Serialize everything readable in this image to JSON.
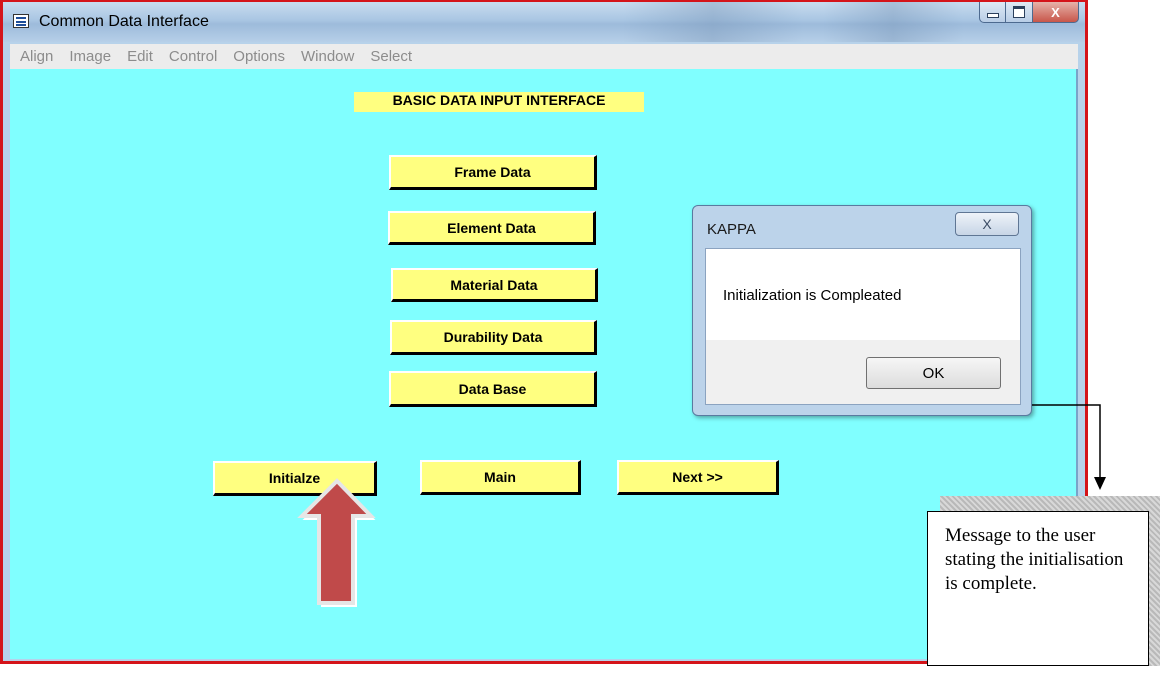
{
  "window": {
    "title": "Common Data Interface",
    "close_glyph": "X"
  },
  "menu": [
    "Align",
    "Image",
    "Edit",
    "Control",
    "Options",
    "Window",
    "Select"
  ],
  "heading": "BASIC DATA INPUT INTERFACE",
  "data_buttons": [
    "Frame Data",
    "Element Data",
    "Material Data",
    "Durability Data",
    "Data Base"
  ],
  "nav_buttons": [
    "Initialze",
    "Main",
    "Next >>"
  ],
  "dialog": {
    "title": "KAPPA",
    "close_glyph": "X",
    "message": "Initialization is Compleated",
    "ok_label": "OK"
  },
  "callout": {
    "text": "Message to the user stating the initialisation is complete."
  },
  "colors": {
    "client_bg": "#80ffff",
    "button_bg": "#ffff80",
    "highlight_frame": "#d4141a",
    "arrow": "#c04a4a"
  },
  "icons": [
    "app-icon",
    "minimize-icon",
    "maximize-icon",
    "close-icon",
    "up-arrow-icon",
    "down-arrow-icon"
  ]
}
